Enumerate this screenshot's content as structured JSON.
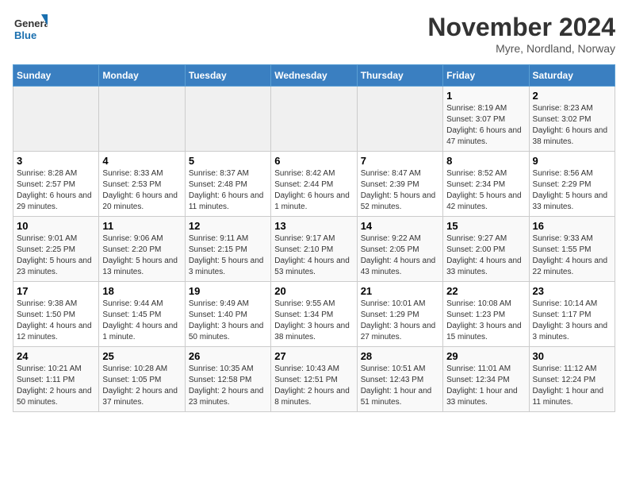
{
  "logo": {
    "line1": "General",
    "line2": "Blue"
  },
  "header": {
    "month": "November 2024",
    "location": "Myre, Nordland, Norway"
  },
  "weekdays": [
    "Sunday",
    "Monday",
    "Tuesday",
    "Wednesday",
    "Thursday",
    "Friday",
    "Saturday"
  ],
  "weeks": [
    [
      {
        "day": "",
        "info": ""
      },
      {
        "day": "",
        "info": ""
      },
      {
        "day": "",
        "info": ""
      },
      {
        "day": "",
        "info": ""
      },
      {
        "day": "",
        "info": ""
      },
      {
        "day": "1",
        "info": "Sunrise: 8:19 AM\nSunset: 3:07 PM\nDaylight: 6 hours and 47 minutes."
      },
      {
        "day": "2",
        "info": "Sunrise: 8:23 AM\nSunset: 3:02 PM\nDaylight: 6 hours and 38 minutes."
      }
    ],
    [
      {
        "day": "3",
        "info": "Sunrise: 8:28 AM\nSunset: 2:57 PM\nDaylight: 6 hours and 29 minutes."
      },
      {
        "day": "4",
        "info": "Sunrise: 8:33 AM\nSunset: 2:53 PM\nDaylight: 6 hours and 20 minutes."
      },
      {
        "day": "5",
        "info": "Sunrise: 8:37 AM\nSunset: 2:48 PM\nDaylight: 6 hours and 11 minutes."
      },
      {
        "day": "6",
        "info": "Sunrise: 8:42 AM\nSunset: 2:44 PM\nDaylight: 6 hours and 1 minute."
      },
      {
        "day": "7",
        "info": "Sunrise: 8:47 AM\nSunset: 2:39 PM\nDaylight: 5 hours and 52 minutes."
      },
      {
        "day": "8",
        "info": "Sunrise: 8:52 AM\nSunset: 2:34 PM\nDaylight: 5 hours and 42 minutes."
      },
      {
        "day": "9",
        "info": "Sunrise: 8:56 AM\nSunset: 2:29 PM\nDaylight: 5 hours and 33 minutes."
      }
    ],
    [
      {
        "day": "10",
        "info": "Sunrise: 9:01 AM\nSunset: 2:25 PM\nDaylight: 5 hours and 23 minutes."
      },
      {
        "day": "11",
        "info": "Sunrise: 9:06 AM\nSunset: 2:20 PM\nDaylight: 5 hours and 13 minutes."
      },
      {
        "day": "12",
        "info": "Sunrise: 9:11 AM\nSunset: 2:15 PM\nDaylight: 5 hours and 3 minutes."
      },
      {
        "day": "13",
        "info": "Sunrise: 9:17 AM\nSunset: 2:10 PM\nDaylight: 4 hours and 53 minutes."
      },
      {
        "day": "14",
        "info": "Sunrise: 9:22 AM\nSunset: 2:05 PM\nDaylight: 4 hours and 43 minutes."
      },
      {
        "day": "15",
        "info": "Sunrise: 9:27 AM\nSunset: 2:00 PM\nDaylight: 4 hours and 33 minutes."
      },
      {
        "day": "16",
        "info": "Sunrise: 9:33 AM\nSunset: 1:55 PM\nDaylight: 4 hours and 22 minutes."
      }
    ],
    [
      {
        "day": "17",
        "info": "Sunrise: 9:38 AM\nSunset: 1:50 PM\nDaylight: 4 hours and 12 minutes."
      },
      {
        "day": "18",
        "info": "Sunrise: 9:44 AM\nSunset: 1:45 PM\nDaylight: 4 hours and 1 minute."
      },
      {
        "day": "19",
        "info": "Sunrise: 9:49 AM\nSunset: 1:40 PM\nDaylight: 3 hours and 50 minutes."
      },
      {
        "day": "20",
        "info": "Sunrise: 9:55 AM\nSunset: 1:34 PM\nDaylight: 3 hours and 38 minutes."
      },
      {
        "day": "21",
        "info": "Sunrise: 10:01 AM\nSunset: 1:29 PM\nDaylight: 3 hours and 27 minutes."
      },
      {
        "day": "22",
        "info": "Sunrise: 10:08 AM\nSunset: 1:23 PM\nDaylight: 3 hours and 15 minutes."
      },
      {
        "day": "23",
        "info": "Sunrise: 10:14 AM\nSunset: 1:17 PM\nDaylight: 3 hours and 3 minutes."
      }
    ],
    [
      {
        "day": "24",
        "info": "Sunrise: 10:21 AM\nSunset: 1:11 PM\nDaylight: 2 hours and 50 minutes."
      },
      {
        "day": "25",
        "info": "Sunrise: 10:28 AM\nSunset: 1:05 PM\nDaylight: 2 hours and 37 minutes."
      },
      {
        "day": "26",
        "info": "Sunrise: 10:35 AM\nSunset: 12:58 PM\nDaylight: 2 hours and 23 minutes."
      },
      {
        "day": "27",
        "info": "Sunrise: 10:43 AM\nSunset: 12:51 PM\nDaylight: 2 hours and 8 minutes."
      },
      {
        "day": "28",
        "info": "Sunrise: 10:51 AM\nSunset: 12:43 PM\nDaylight: 1 hour and 51 minutes."
      },
      {
        "day": "29",
        "info": "Sunrise: 11:01 AM\nSunset: 12:34 PM\nDaylight: 1 hour and 33 minutes."
      },
      {
        "day": "30",
        "info": "Sunrise: 11:12 AM\nSunset: 12:24 PM\nDaylight: 1 hour and 11 minutes."
      }
    ]
  ]
}
